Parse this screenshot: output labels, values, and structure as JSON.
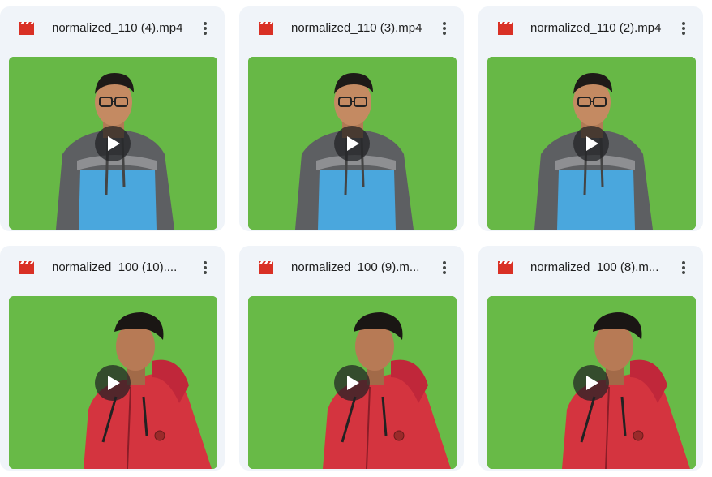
{
  "files": [
    {
      "name": "normalized_110 (4).mp4",
      "type_icon": "video-clapperboard-icon",
      "subject": "glasses-hoodie"
    },
    {
      "name": "normalized_110 (3).mp4",
      "type_icon": "video-clapperboard-icon",
      "subject": "glasses-hoodie"
    },
    {
      "name": "normalized_110 (2).mp4",
      "type_icon": "video-clapperboard-icon",
      "subject": "glasses-hoodie"
    },
    {
      "name": "normalized_100 (10)....",
      "type_icon": "video-clapperboard-icon",
      "subject": "red-jacket"
    },
    {
      "name": "normalized_100 (9).m...",
      "type_icon": "video-clapperboard-icon",
      "subject": "red-jacket"
    },
    {
      "name": "normalized_100 (8).m...",
      "type_icon": "video-clapperboard-icon",
      "subject": "red-jacket"
    }
  ],
  "colors": {
    "card_background": "#f0f4f9",
    "video_icon": "#d93025",
    "green_screen": "#6cbd4a",
    "hoodie_blue": "#4aa7dd",
    "hoodie_gray": "#5d5f62",
    "jacket_red": "#d4343f"
  }
}
